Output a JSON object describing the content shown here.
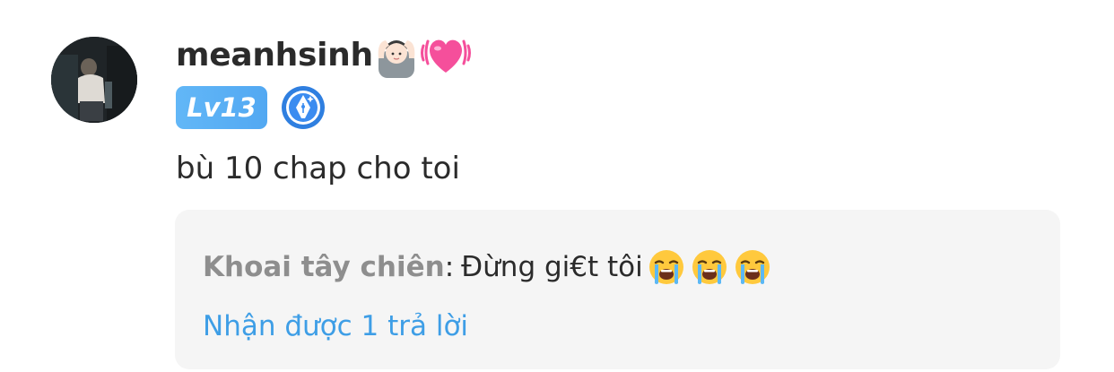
{
  "comment": {
    "username": "meanhsinh",
    "username_emojis": [
      "person-gesturing-ok-icon",
      "beating-heart-icon"
    ],
    "level": "Lv13",
    "badge_icon": "fountain-pen-badge-icon",
    "text": "bù 10 chap cho toi",
    "avatar_icon": "user-avatar-photo"
  },
  "reply": {
    "author": "Khoai tây chiên",
    "separator": ":",
    "text": "Đừng gi€t tôi",
    "emojis": [
      "loudly-crying-face-icon",
      "loudly-crying-face-icon",
      "loudly-crying-face-icon"
    ],
    "view_replies_label": "Nhận được 1 trả lời"
  },
  "colors": {
    "level_badge": "#56adf4",
    "link": "#3e9ee6",
    "reply_bg": "#f5f5f5",
    "author": "#8e8e8e",
    "text": "#2b2b2b"
  }
}
